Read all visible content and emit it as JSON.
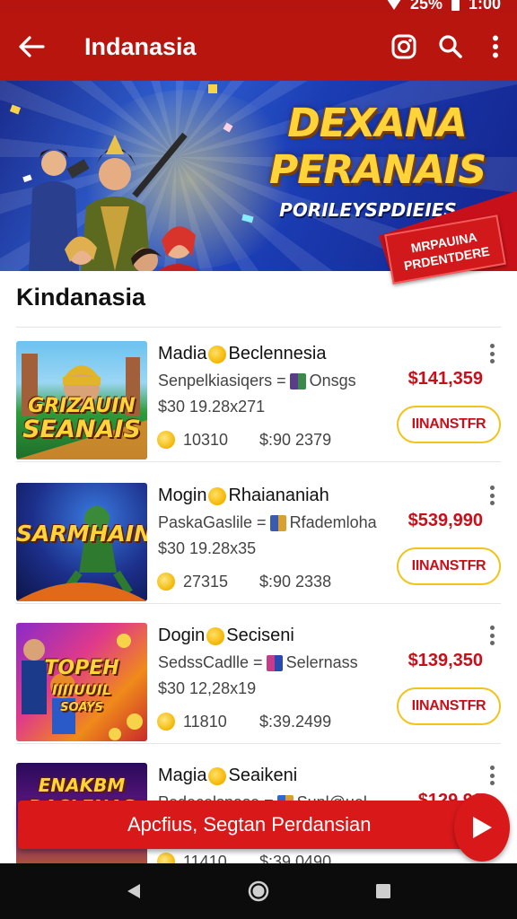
{
  "status_bar": {
    "battery": "25%",
    "time": "1:00"
  },
  "app_bar": {
    "title": "Indanasia",
    "icons": [
      "back-arrow-icon",
      "instagram-icon",
      "search-icon",
      "more-vert-icon"
    ]
  },
  "banner": {
    "title_line1": "DEXANA",
    "title_line2": "PERANAIS",
    "subtitle": "PORILEYSPDIEIES",
    "tag_line1": "MRPAUINA",
    "tag_line2": "PRDENTDERE"
  },
  "section": {
    "title": "Kindanasia"
  },
  "items": [
    {
      "title_a": "Madia",
      "title_b": "Beclennesia",
      "sub_a": "Senpelkiasiqers =",
      "sub_b": "Onsgs",
      "meta": "$30 19.28x271",
      "price": "$141,359",
      "stat_a": "10310",
      "stat_b": "$:90 2379",
      "button": "IINANSTFR",
      "thumb_text": [
        "GRIZAUIN",
        "SEANAIS"
      ]
    },
    {
      "title_a": "Mogin",
      "title_b": "Rhaiananiah",
      "sub_a": "PaskaGaslile =",
      "sub_b": "Rfademloha",
      "meta": "$30 19.28x35",
      "price": "$539,990",
      "stat_a": "27315",
      "stat_b": "$:90 2338",
      "button": "IINANSTFR",
      "thumb_text": [
        "SARMHAIN"
      ]
    },
    {
      "title_a": "Dogin",
      "title_b": "Seciseni",
      "sub_a": "SedssCadlle =",
      "sub_b": "Selernass",
      "meta": "$30 12,28x19",
      "price": "$139,350",
      "stat_a": "11810",
      "stat_b": "$:39.2499",
      "button": "IINANSTFR",
      "thumb_text": [
        "TOPEH",
        "IIIIUUIL",
        "SOAYS"
      ]
    },
    {
      "title_a": "Magia",
      "title_b": "Seaikeni",
      "sub_a": "Pedecelsnase =",
      "sub_b": "Sunl@uel",
      "meta": "",
      "price": "$129,90",
      "stat_a": "11410",
      "stat_b": "$:39.0490",
      "button": "",
      "thumb_text": [
        "ENAKBM",
        "DACLENAS"
      ]
    }
  ],
  "cta": {
    "label": "Apcfius, Segtan Perdansian"
  },
  "nav": {
    "icons": [
      "back-triangle-icon",
      "home-circle-icon",
      "recents-square-icon"
    ]
  },
  "colors": {
    "primary": "#b9150f",
    "accent": "#f2c31a",
    "price": "#c8101a"
  }
}
